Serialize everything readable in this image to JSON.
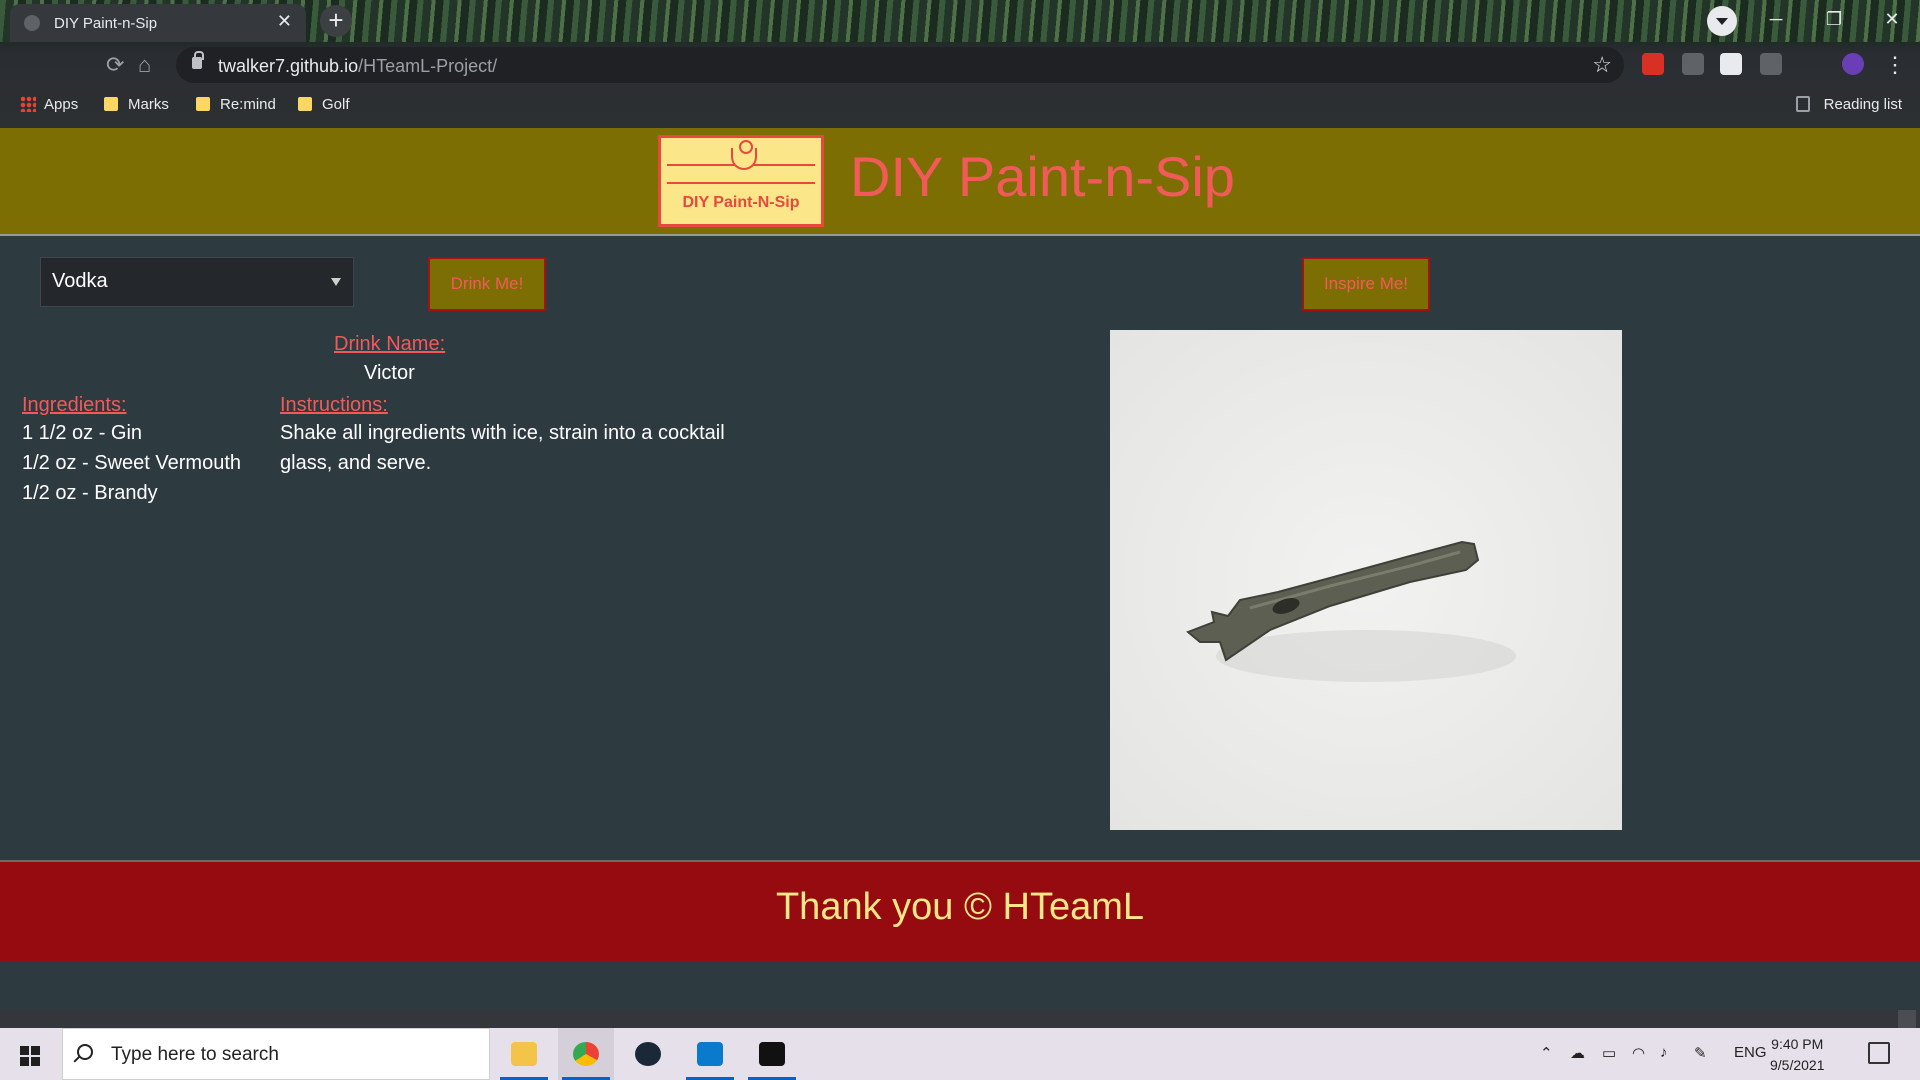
{
  "browser": {
    "tab_title": "DIY Paint-n-Sip",
    "tab_close": "✕",
    "new_tab": "+",
    "url_host": "twalker7.github.io",
    "url_path": "/HTeamL-Project/",
    "bookmarks": [
      "Apps",
      "Marks",
      "Re:mind",
      "Golf"
    ],
    "reading_list": "Reading list",
    "window_controls": [
      "─",
      "❐",
      "✕"
    ]
  },
  "header": {
    "logo_text": "DIY Paint-N-Sip",
    "title": "DIY Paint-n-Sip"
  },
  "controls": {
    "spirit_selected": "Vodka",
    "drink_button": "Drink Me!",
    "inspire_button": "Inspire Me!"
  },
  "drink": {
    "name_label": "Drink Name:",
    "name": "Victor",
    "ingredients_label": "Ingredients:",
    "ingredients": [
      "1 1/2 oz - Gin",
      "1/2 oz - Sweet Vermouth",
      "1/2 oz - Brandy"
    ],
    "instructions_label": "Instructions:",
    "instructions": "Shake all ingredients with ice, strain into a cocktail glass, and serve."
  },
  "footer": {
    "text": "Thank you © HTeamL"
  },
  "taskbar": {
    "search_placeholder": "Type here to search",
    "language": "ENG",
    "time": "9:40 PM",
    "date": "9/5/2021"
  },
  "colors": {
    "header_bg": "#7c6e03",
    "accent_red": "#f25a5a",
    "page_bg": "#2d3a40",
    "footer_bg": "#960b10",
    "footer_text": "#fbe789"
  }
}
